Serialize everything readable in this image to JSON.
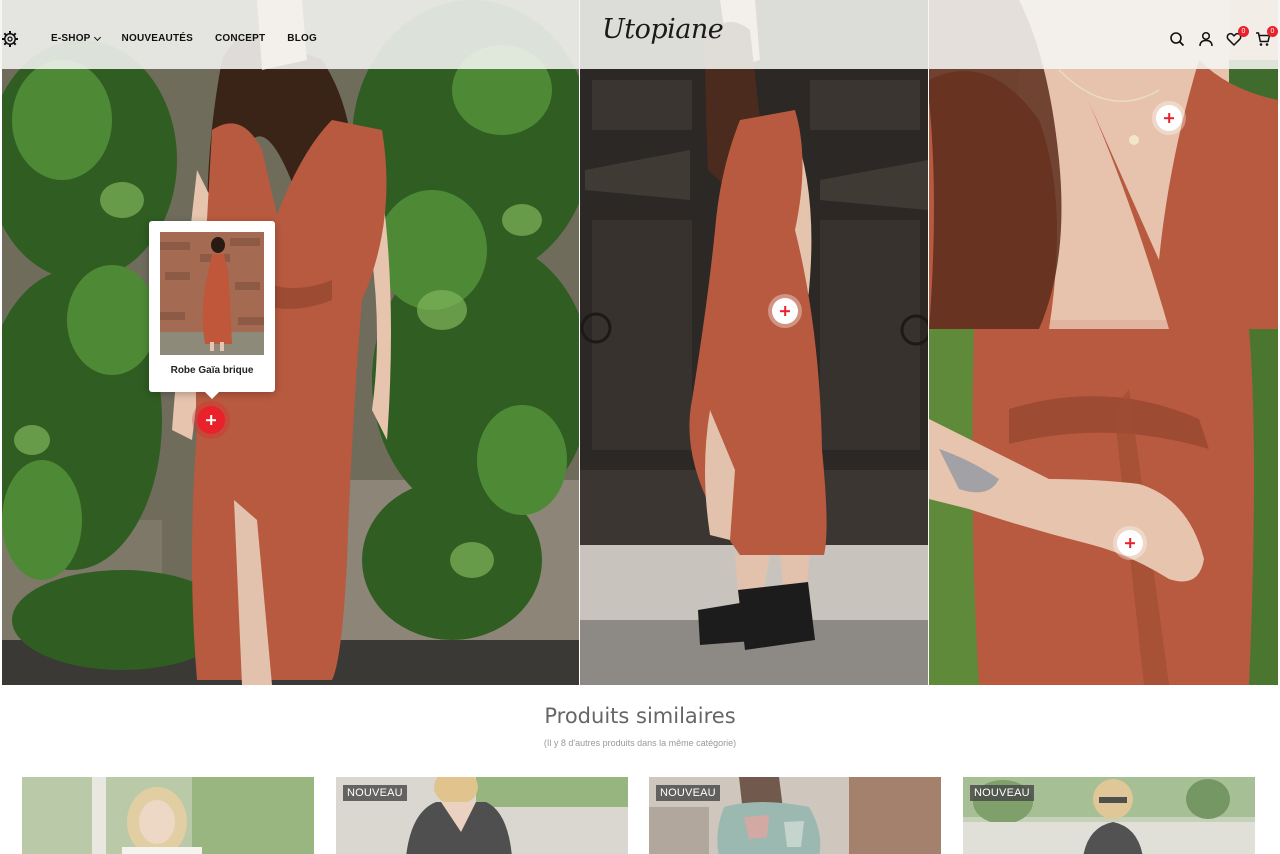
{
  "header": {
    "logo": "Utopiane",
    "nav": [
      {
        "label": "E-SHOP",
        "has_dropdown": true
      },
      {
        "label": "NOUVEAUTÉS"
      },
      {
        "label": "CONCEPT"
      },
      {
        "label": "BLOG"
      }
    ],
    "wishlist_count": "0",
    "cart_count": "0",
    "icons": [
      "gear-icon",
      "search-icon",
      "user-icon",
      "heart-icon",
      "cart-icon"
    ]
  },
  "lookbook": {
    "popup_product": "Robe Gaïa brique"
  },
  "similar": {
    "title": "Produits similaires",
    "subtitle": "(Il y 8 d'autres produits dans la même catégorie)",
    "cards": [
      {
        "tag": ""
      },
      {
        "tag": "NOUVEAU"
      },
      {
        "tag": "NOUVEAU"
      },
      {
        "tag": "NOUVEAU"
      }
    ]
  },
  "colors": {
    "accent": "#e8212b",
    "dress": "#b85a3f"
  }
}
